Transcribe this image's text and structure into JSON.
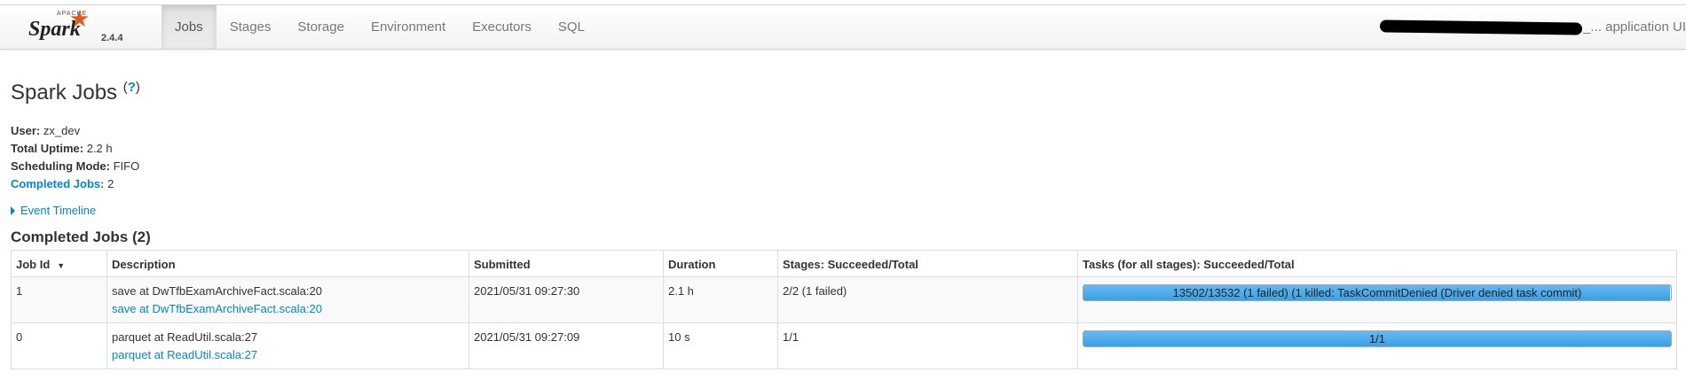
{
  "brand": {
    "apache": "APACHE",
    "name": "Spark",
    "version": "2.4.4"
  },
  "nav": {
    "tabs": [
      {
        "label": "Jobs",
        "active": true
      },
      {
        "label": "Stages",
        "active": false
      },
      {
        "label": "Storage",
        "active": false
      },
      {
        "label": "Environment",
        "active": false
      },
      {
        "label": "Executors",
        "active": false
      },
      {
        "label": "SQL",
        "active": false
      }
    ],
    "app_title_suffix": "_... application UI"
  },
  "page": {
    "title": "Spark Jobs",
    "help": "?",
    "summary": {
      "user_label": "User:",
      "user": "zx_dev",
      "uptime_label": "Total Uptime:",
      "uptime": "2.2 h",
      "scheduling_label": "Scheduling Mode:",
      "scheduling": "FIFO",
      "completed_label": "Completed Jobs:",
      "completed": "2"
    },
    "event_timeline": "Event Timeline",
    "section_title": "Completed Jobs (2)"
  },
  "table": {
    "headers": {
      "job_id": "Job Id",
      "description": "Description",
      "submitted": "Submitted",
      "duration": "Duration",
      "stages": "Stages: Succeeded/Total",
      "tasks": "Tasks (for all stages): Succeeded/Total"
    },
    "rows": [
      {
        "job_id": "1",
        "desc": "save at DwTfbExamArchiveFact.scala:20",
        "desc_link": "save at DwTfbExamArchiveFact.scala:20",
        "submitted": "2021/05/31 09:27:30",
        "duration": "2.1 h",
        "stages": "2/2 (1 failed)",
        "tasks_text": "13502/13532 (1 failed) (1 killed: TaskCommitDenied (Driver denied task commit)",
        "tasks_progress": 0.9978
      },
      {
        "job_id": "0",
        "desc": "parquet at ReadUtil.scala:27",
        "desc_link": "parquet at ReadUtil.scala:27",
        "submitted": "2021/05/31 09:27:09",
        "duration": "10 s",
        "stages": "1/1",
        "tasks_text": "1/1",
        "tasks_progress": 1.0
      }
    ]
  }
}
